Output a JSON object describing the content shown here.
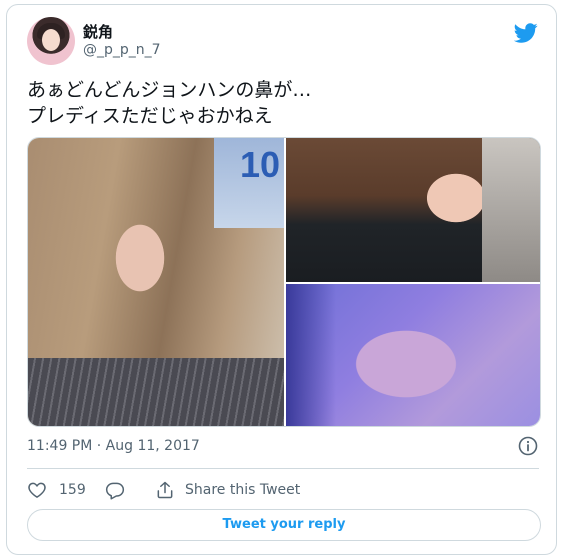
{
  "author": {
    "display_name": "鋭角",
    "handle": "@_p_p_n_7",
    "avatar_icon": "user-avatar"
  },
  "tweet": {
    "text": "あぁどんどんジョンハンの鼻が…\nプレディスただじゃおかねえ",
    "timestamp": "11:49 PM · Aug 11, 2017"
  },
  "media": {
    "photo_1_sign": "10"
  },
  "actions": {
    "like_count": "159",
    "share_label": "Share this Tweet",
    "reply_button_label": "Tweet your reply"
  },
  "icons": {
    "brand": "twitter-bird-icon",
    "info": "info-icon",
    "like": "heart-icon",
    "reply": "reply-bubble-icon",
    "share": "share-icon"
  },
  "colors": {
    "accent": "#1d9bf0",
    "text_primary": "#0f1419",
    "text_secondary": "#536471",
    "border": "#cfd9de"
  }
}
